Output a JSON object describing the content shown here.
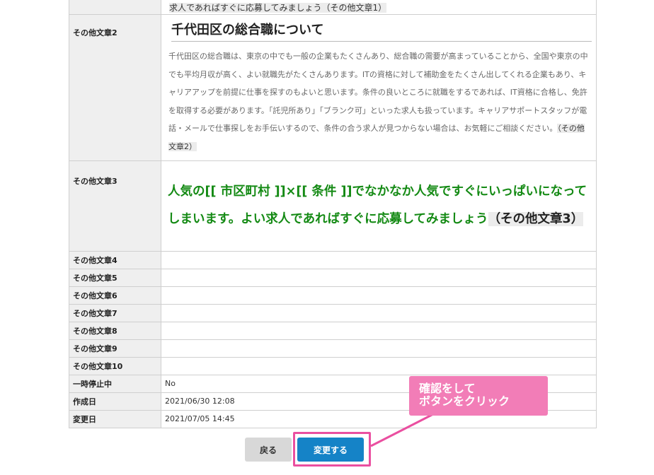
{
  "table": {
    "top_cut_text": "求人であればすぐに応募してみましょう（その他文章1）",
    "row2": {
      "label": "その他文章2",
      "heading": "千代田区の総合職について",
      "paragraph": "千代田区の総合職は、東京の中でも一般の企業もたくさんあり、総合職の需要が高まっていることから、全国や東京の中でも平均月収が高く、よい就職先がたくさんあります。ITの資格に対して補助金をたくさん出してくれる企業もあり、キャリアアップを前提に仕事を探すのもよいと思います。条件の良いところに就職をするであれば、IT資格に合格し、免許を取得する必要があります。「託児所あり」「ブランク可」といった求人も扱っています。キャリアサポートスタッフが電話・メールで仕事探しをお手伝いするので、条件の合う求人が見つからない場合は、お気軽にご相談ください。",
      "paragraph_tag": "（その他文章2）"
    },
    "row3": {
      "label": "その他文章3",
      "text": "人気の[[ 市区町村 ]]×[[ 条件 ]]でなかなか人気ですぐにいっぱいになってしまいます。よい求人であればすぐに応募してみましょう",
      "tag": "（その他文章3）"
    },
    "empty_rows": [
      "その他文章4",
      "その他文章5",
      "その他文章6",
      "その他文章7",
      "その他文章8",
      "その他文章9",
      "その他文章10"
    ],
    "info_rows": [
      {
        "label": "一時停止中",
        "value": "No"
      },
      {
        "label": "作成日",
        "value": "2021/06/30 12:08"
      },
      {
        "label": "変更日",
        "value": "2021/07/05 14:45"
      }
    ]
  },
  "buttons": {
    "back_label": "戻る",
    "submit_label": "変更する"
  },
  "callout": {
    "line1": "確認をして",
    "line2": "ボタンをクリック"
  },
  "colors": {
    "accent_pink": "#f27db7",
    "highlight_border": "#ea4fa0",
    "submit_blue": "#1583c7",
    "green_text": "#148a14"
  }
}
